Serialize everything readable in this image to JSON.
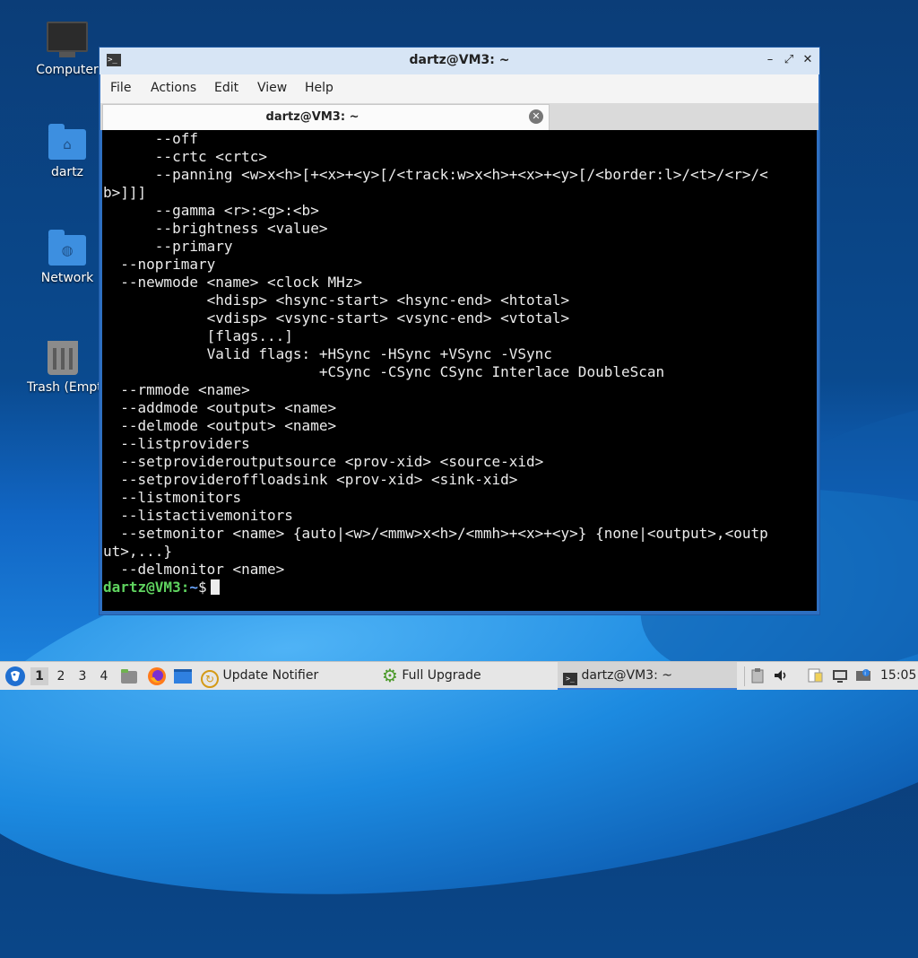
{
  "desktop": {
    "icons": [
      {
        "label": "Computer",
        "icon": "computer-icon"
      },
      {
        "label": "dartz",
        "icon": "home-folder-icon"
      },
      {
        "label": "Network",
        "icon": "network-folder-icon"
      },
      {
        "label": "Trash (Empty)",
        "icon": "trash-icon"
      }
    ]
  },
  "window": {
    "title": "dartz@VM3: ~",
    "menu": [
      "File",
      "Actions",
      "Edit",
      "View",
      "Help"
    ],
    "tab_label": "dartz@VM3: ~",
    "terminal_lines": [
      "      --off",
      "      --crtc <crtc>",
      "      --panning <w>x<h>[+<x>+<y>[/<track:w>x<h>+<x>+<y>[/<border:l>/<t>/<r>/<",
      "b>]]]",
      "      --gamma <r>:<g>:<b>",
      "      --brightness <value>",
      "      --primary",
      "  --noprimary",
      "  --newmode <name> <clock MHz>",
      "            <hdisp> <hsync-start> <hsync-end> <htotal>",
      "            <vdisp> <vsync-start> <vsync-end> <vtotal>",
      "            [flags...]",
      "            Valid flags: +HSync -HSync +VSync -VSync",
      "                         +CSync -CSync CSync Interlace DoubleScan",
      "  --rmmode <name>",
      "  --addmode <output> <name>",
      "  --delmode <output> <name>",
      "  --listproviders",
      "  --setprovideroutputsource <prov-xid> <source-xid>",
      "  --setprovideroffloadsink <prov-xid> <sink-xid>",
      "  --listmonitors",
      "  --listactivemonitors",
      "  --setmonitor <name> {auto|<w>/<mmw>x<h>/<mmh>+<x>+<y>} {none|<output>,<outp",
      "ut>,...}",
      "  --delmonitor <name>"
    ],
    "prompt": {
      "user_host": "dartz@VM3",
      "sep": ":",
      "path": "~",
      "symbol": "$"
    }
  },
  "taskbar": {
    "workspaces": [
      "1",
      "2",
      "3",
      "4"
    ],
    "active_workspace": "1",
    "tasks": [
      "Update Notifier",
      "Full Upgrade",
      "dartz@VM3: ~"
    ],
    "clock": "15:05"
  },
  "colors": {
    "prompt_user": "#5fd35f",
    "prompt_path": "#6ba7ff",
    "window_frame": "#2d6fc1",
    "terminal_bg": "#000000"
  }
}
